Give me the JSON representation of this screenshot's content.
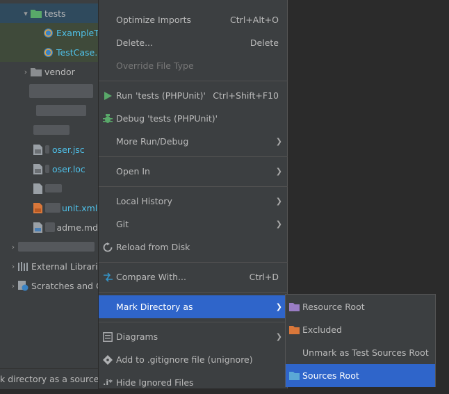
{
  "tree": {
    "rows": [
      {
        "label": "tests",
        "kind": "folder-open"
      },
      {
        "label": "ExampleTe",
        "kind": "php-class"
      },
      {
        "label": "TestCase.p",
        "kind": "php-class"
      },
      {
        "label": "vendor",
        "kind": "folder"
      },
      {
        "label": "oser.jsc",
        "kind": "json-file"
      },
      {
        "label": "oser.loc",
        "kind": "json-file"
      },
      {
        "label": "unit.xml",
        "kind": "xml-file"
      },
      {
        "label": "adme.md",
        "kind": "md-file"
      },
      {
        "label": "External Librarie",
        "kind": "libraries"
      },
      {
        "label": "Scratches and C",
        "kind": "scratches"
      }
    ]
  },
  "status_bar": {
    "text": "k directory as a sources"
  },
  "menu": {
    "optimize_imports": {
      "label": "Optimize Imports",
      "shortcut": "Ctrl+Alt+O"
    },
    "delete": {
      "label": "Delete...",
      "shortcut": "Delete"
    },
    "override_file_type": {
      "label": "Override File Type"
    },
    "run": {
      "label": "Run 'tests (PHPUnit)'",
      "shortcut": "Ctrl+Shift+F10"
    },
    "debug": {
      "label": "Debug 'tests (PHPUnit)'"
    },
    "more_run_debug": {
      "label": "More Run/Debug"
    },
    "open_in": {
      "label": "Open In"
    },
    "local_history": {
      "label": "Local History"
    },
    "git": {
      "label": "Git"
    },
    "reload_from_disk": {
      "label": "Reload from Disk"
    },
    "compare_with": {
      "label": "Compare With...",
      "shortcut": "Ctrl+D"
    },
    "mark_directory_as": {
      "label": "Mark Directory as"
    },
    "diagrams": {
      "label": "Diagrams"
    },
    "add_to_gitignore": {
      "label": "Add to .gitignore file (unignore)"
    },
    "hide_ignored_files": {
      "label": "Hide Ignored Files"
    }
  },
  "submenu": {
    "resource_root": {
      "label": "Resource Root"
    },
    "excluded": {
      "label": "Excluded"
    },
    "unmark_test_sources": {
      "label": "Unmark as Test Sources Root"
    },
    "sources_root": {
      "label": "Sources Root"
    }
  },
  "colors": {
    "background": "#2b2b2b",
    "panel": "#3c3f41",
    "selection": "#2f65ca",
    "text": "#bbbbbb",
    "run_green": "#59a869",
    "folder_blue": "#5aa8d6",
    "resource_purple": "#9a7dc4",
    "excluded_orange": "#d9773a"
  }
}
